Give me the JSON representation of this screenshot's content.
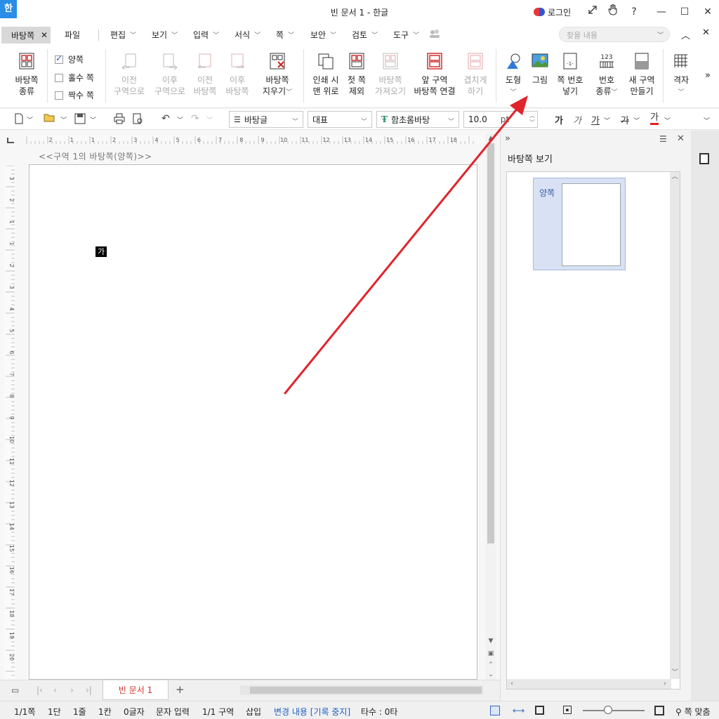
{
  "title_bar": {
    "app_icon": "한",
    "title": "빈 문서 1 - 한글",
    "login": "로그인",
    "icons": [
      "expand-icon",
      "hand-icon",
      "help-icon",
      "minimize-icon",
      "maximize-icon",
      "close-icon"
    ],
    "help": "?",
    "minimize": "—",
    "maximize": "☐",
    "close": "✕"
  },
  "menu": {
    "active_tab": "바탕쪽",
    "active_tab_close": "✕",
    "file": "파일",
    "items": [
      "편집",
      "보기",
      "입력",
      "서식",
      "쪽",
      "보안",
      "검토",
      "도구"
    ],
    "search_placeholder": "찾을 내용"
  },
  "ribbon": {
    "master_type": [
      "바탕쪽",
      "종류"
    ],
    "checkboxes": [
      {
        "label": "양쪽",
        "checked": true
      },
      {
        "label": "홀수 쪽",
        "checked": false
      },
      {
        "label": "짝수 쪽",
        "checked": false
      }
    ],
    "prev_section": [
      "이전",
      "구역으로"
    ],
    "next_section": [
      "이후",
      "구역으로"
    ],
    "prev_master": [
      "이전",
      "바탕쪽"
    ],
    "next_master": [
      "이후",
      "바탕쪽"
    ],
    "delete_master": [
      "바탕쪽",
      "지우기"
    ],
    "print_on_top": [
      "인쇄 시",
      "맨 위로"
    ],
    "exclude_first": [
      "첫 쪽",
      "제외"
    ],
    "import_master": [
      "바탕쪽",
      "가져오기"
    ],
    "link_prev": [
      "앞 구역",
      "바탕쪽 연결"
    ],
    "overlap": [
      "겹치게",
      "하기"
    ],
    "shape": "도형",
    "picture": "그림",
    "page_number": [
      "쪽 번호",
      "넣기"
    ],
    "number_type": [
      "번호",
      "종류"
    ],
    "new_section": [
      "새 구역",
      "만들기"
    ],
    "grid": "격자",
    "number_icon_text": "123",
    "page_num_icon_text": "-1-"
  },
  "toolbar": {
    "style": "바탕글",
    "font_lang": "대표",
    "font": "함초롬바탕",
    "size": "10.0",
    "unit": "pt",
    "bold_char": "가",
    "italic_char": "가",
    "underline_char": "가",
    "strike_char": "가",
    "color_char": "가",
    "accent_color": "#e02020"
  },
  "document": {
    "section_label": "<<구역 1의 바탕쪽(양쪽)>>",
    "cursor_char": "가",
    "ruler_numbers": [
      "2",
      "1",
      "1",
      "2",
      "3",
      "4",
      "5",
      "6",
      "7",
      "8",
      "9",
      "10",
      "11",
      "12",
      "13",
      "14",
      "15",
      "16",
      "17",
      "18"
    ],
    "vruler_numbers": [
      "3",
      "2",
      "1",
      "1",
      "2",
      "3",
      "4",
      "5",
      "6",
      "7",
      "8",
      "9",
      "10",
      "11",
      "12",
      "13",
      "14",
      "15",
      "16",
      "17",
      "18",
      "19",
      "20"
    ],
    "tab_name": "빈 문서 1",
    "add_tab": "+"
  },
  "side_panel": {
    "title": "바탕쪽 보기",
    "item_label": "양쪽"
  },
  "status": {
    "page": "1/1쪽",
    "column": "1단",
    "line": "1줄",
    "col": "1칸",
    "chars": "0글자",
    "mode": "문자 입력",
    "section": "1/1 구역",
    "insert": "삽입",
    "track_changes": "변경 내용 [기록 중지]",
    "typing": "타수 : 0타",
    "fit": "쪽 맞춤"
  },
  "annotation": {
    "arrow_color": "#e0242c"
  }
}
